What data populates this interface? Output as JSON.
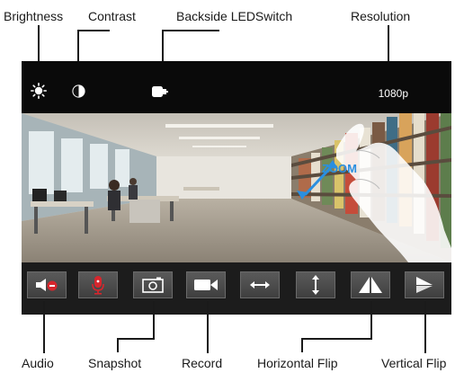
{
  "callouts": {
    "brightness": "Brightness",
    "contrast": "Contrast",
    "backside_led": "Backside LEDSwitch",
    "resolution": "Resolution",
    "audio": "Audio",
    "snapshot": "Snapshot",
    "record": "Record",
    "horizontal_flip": "Horizontal Flip",
    "vertical_flip": "Vertical Flip"
  },
  "topbar": {
    "resolution_value": "1080p",
    "icons": [
      "sun-icon",
      "contrast-icon",
      "led-icon"
    ]
  },
  "video": {
    "overlay_text": "ZOOM",
    "gesture": "pinch-zoom-hand-icon"
  },
  "controls": [
    {
      "name": "audio-button",
      "icon": "speaker-mute-icon"
    },
    {
      "name": "talk-button",
      "icon": "microphone-icon"
    },
    {
      "name": "snapshot-button",
      "icon": "camera-icon"
    },
    {
      "name": "record-button",
      "icon": "video-camera-icon"
    },
    {
      "name": "horizontal-arrows-button",
      "icon": "horizontal-arrows-icon"
    },
    {
      "name": "vertical-arrows-button",
      "icon": "vertical-arrows-icon"
    },
    {
      "name": "horizontal-flip-button",
      "icon": "horizontal-flip-icon"
    },
    {
      "name": "vertical-flip-button",
      "icon": "vertical-flip-icon"
    }
  ],
  "colors": {
    "accent_red": "#d7262d",
    "zoom_blue": "#2a8fe0",
    "bar_bg": "#0a0a0a"
  }
}
